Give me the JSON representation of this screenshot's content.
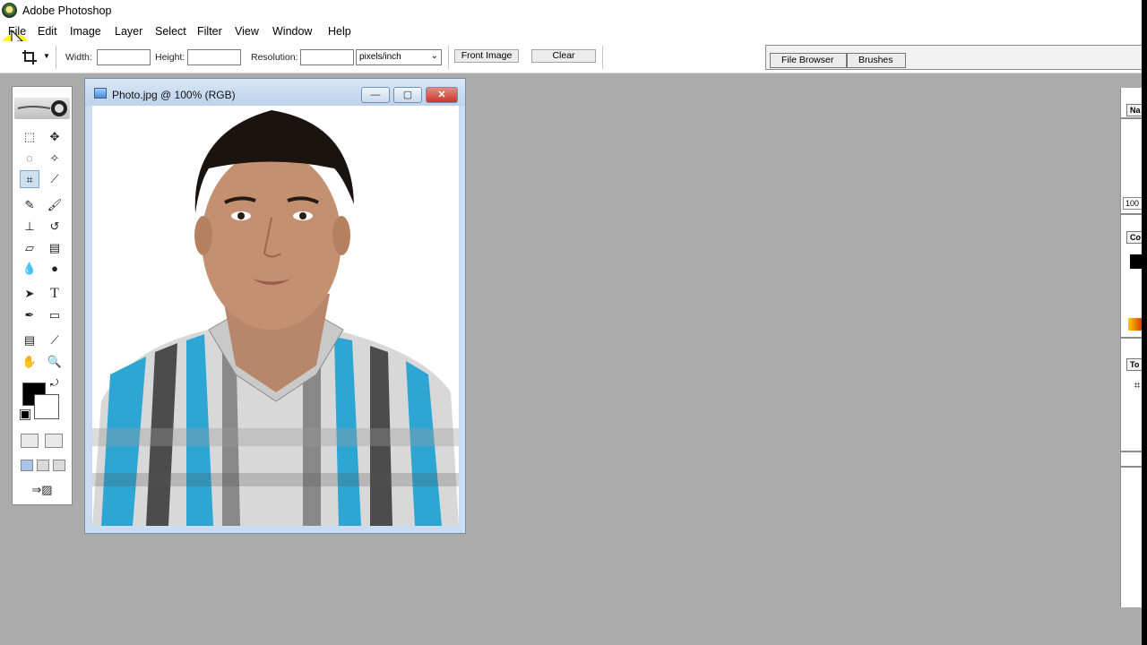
{
  "app": {
    "title": "Adobe Photoshop"
  },
  "menu": [
    "File",
    "Edit",
    "Image",
    "Layer",
    "Select",
    "Filter",
    "View",
    "Window",
    "Help"
  ],
  "options": {
    "width_label": "Width:",
    "height_label": "Height:",
    "resolution_label": "Resolution:",
    "units": "pixels/inch",
    "front_image": "Front Image",
    "clear": "Clear",
    "width_value": "",
    "height_value": "",
    "resolution_value": ""
  },
  "palette_well": {
    "tabs": [
      "File Browser",
      "Brushes"
    ]
  },
  "document": {
    "title": "Photo.jpg @ 100% (RGB)"
  },
  "right_panels": {
    "tab1": "Na",
    "zoom": "100",
    "tab2": "Co",
    "tab3": "To"
  },
  "colors": {
    "foreground": "#000000",
    "background": "#ffffff",
    "workspace": "#ababab",
    "highlight": "#fff200"
  }
}
